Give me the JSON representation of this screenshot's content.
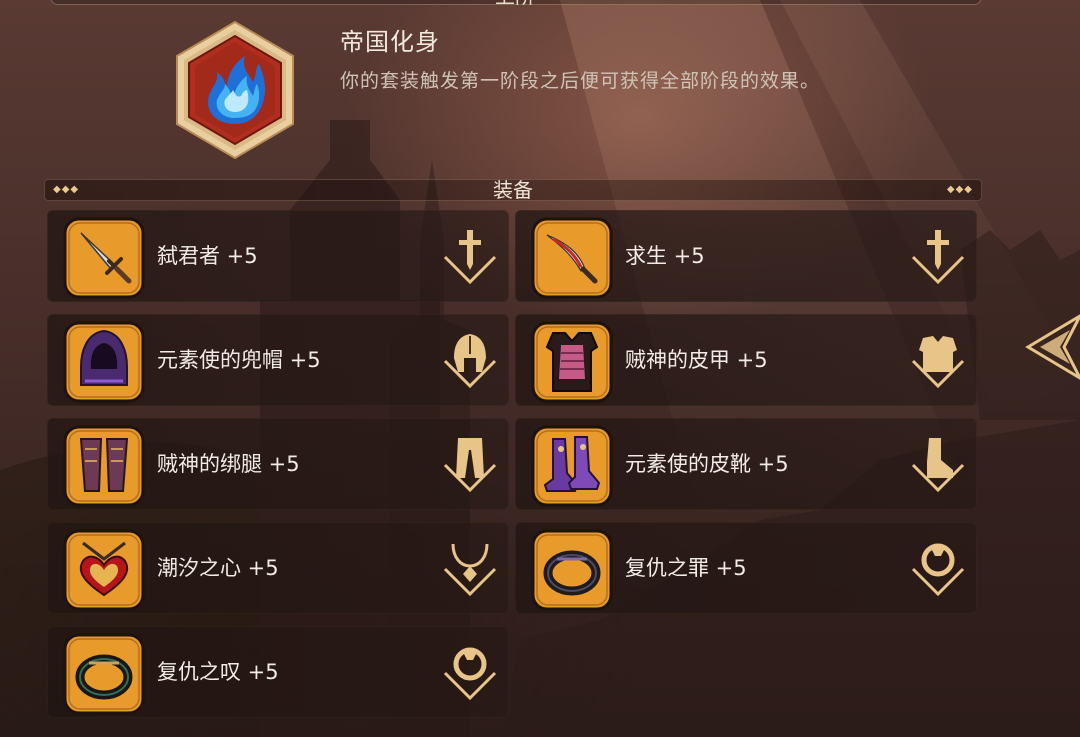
{
  "set": {
    "name": "帝国化身",
    "description": "你的套装触发第一阶段之后便可获得全部阶段的效果。",
    "badge_icon": "blue-flame-icon",
    "top_header": "上阶"
  },
  "equipment_section": {
    "title": "装备"
  },
  "items": [
    {
      "label": "弑君者 +5",
      "icon": "dagger-icon",
      "slot": "weapon-slot-icon"
    },
    {
      "label": "求生 +5",
      "icon": "curved-blade-icon",
      "slot": "weapon-slot-icon"
    },
    {
      "label": "元素使的兜帽 +5",
      "icon": "hood-icon",
      "slot": "helmet-slot-icon"
    },
    {
      "label": "贼神的皮甲 +5",
      "icon": "leather-armor-icon",
      "slot": "chest-slot-icon"
    },
    {
      "label": "贼神的绑腿 +5",
      "icon": "leggings-icon",
      "slot": "legs-slot-icon"
    },
    {
      "label": "元素使的皮靴 +5",
      "icon": "boots-icon",
      "slot": "boots-slot-icon"
    },
    {
      "label": "潮汐之心 +5",
      "icon": "heart-amulet-icon",
      "slot": "amulet-slot-icon"
    },
    {
      "label": "复仇之罪 +5",
      "icon": "ring-icon",
      "slot": "ring-slot-icon"
    },
    {
      "label": "复仇之叹 +5",
      "icon": "ring-icon",
      "slot": "ring-slot-icon"
    }
  ],
  "colors": {
    "icon_frame": "#e89a2a",
    "icon_border": "#c77d18",
    "gold": "#e7c487",
    "text": "#f2ece4"
  }
}
